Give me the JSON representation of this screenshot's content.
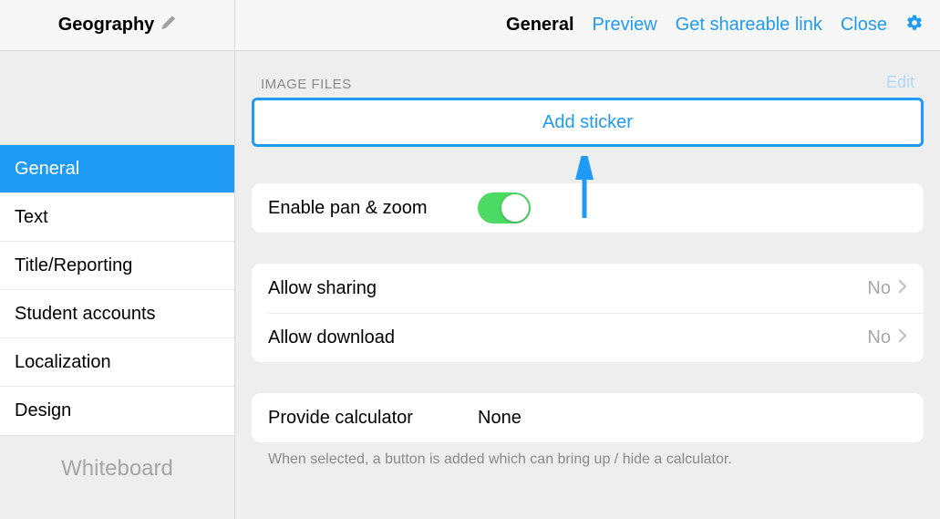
{
  "sidebar": {
    "title": "Geography",
    "items": [
      {
        "label": "General",
        "active": true
      },
      {
        "label": "Text",
        "active": false
      },
      {
        "label": "Title/Reporting",
        "active": false
      },
      {
        "label": "Student accounts",
        "active": false
      },
      {
        "label": "Localization",
        "active": false
      },
      {
        "label": "Design",
        "active": false
      }
    ],
    "footer_label": "Whiteboard"
  },
  "topbar": {
    "current": "General",
    "links": {
      "preview": "Preview",
      "share": "Get shareable link",
      "close": "Close"
    }
  },
  "image_files": {
    "section_label": "IMAGE FILES",
    "edit_label": "Edit",
    "add_button": "Add sticker"
  },
  "settings": {
    "pan_zoom": {
      "label": "Enable pan & zoom",
      "on": true
    },
    "sharing": {
      "label": "Allow sharing",
      "value": "No"
    },
    "download": {
      "label": "Allow download",
      "value": "No"
    },
    "calculator": {
      "label": "Provide calculator",
      "value": "None",
      "helper": "When selected, a button is added which can bring up / hide a calculator."
    }
  }
}
